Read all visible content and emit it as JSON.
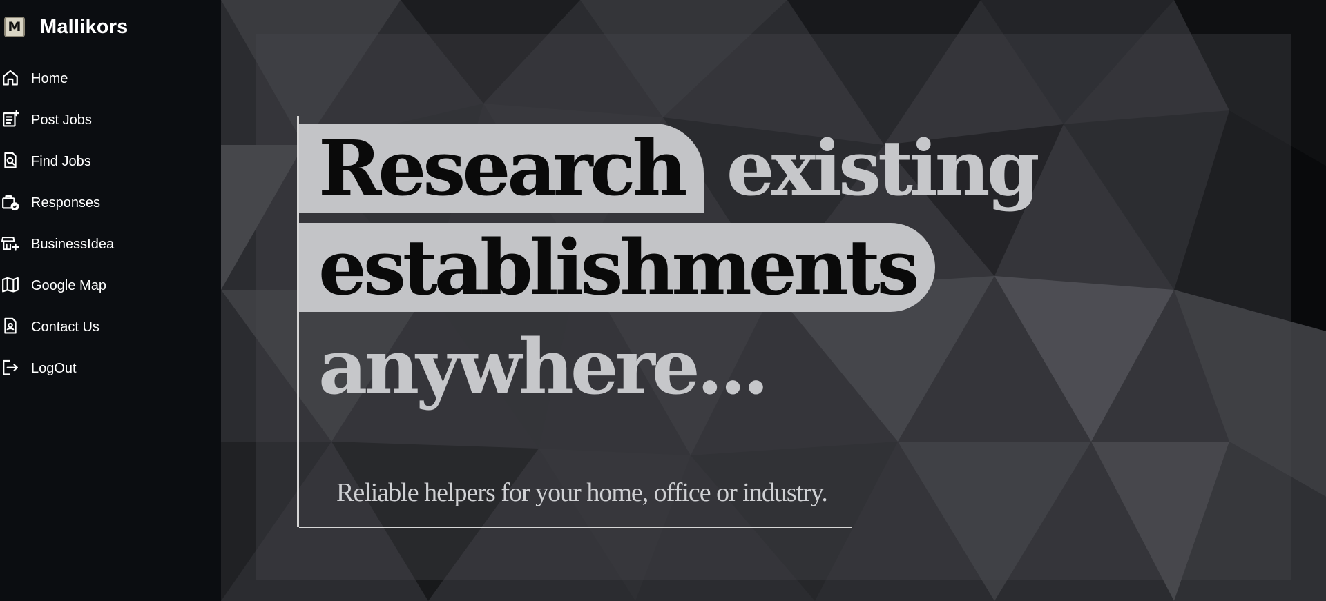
{
  "brand": {
    "logo_letter": "M",
    "name": "Mallikors"
  },
  "nav": {
    "items": [
      {
        "label": "Home",
        "icon": "home-icon"
      },
      {
        "label": "Post Jobs",
        "icon": "post-jobs-icon"
      },
      {
        "label": "Find Jobs",
        "icon": "find-jobs-icon"
      },
      {
        "label": "Responses",
        "icon": "responses-icon"
      },
      {
        "label": "BusinessIdea",
        "icon": "business-idea-icon"
      },
      {
        "label": "Google Map",
        "icon": "map-icon"
      },
      {
        "label": "Contact Us",
        "icon": "contact-icon"
      },
      {
        "label": "LogOut",
        "icon": "logout-icon"
      }
    ]
  },
  "hero": {
    "word_research": "Research",
    "word_existing": "existing",
    "word_establishments": "establishments",
    "word_anywhere": "anywhere...",
    "subtitle": "Reliable helpers for your home, office or industry."
  },
  "colors": {
    "sidebar_bg": "#0b0d11",
    "highlight_bg": "#c3c4c7",
    "text_light": "#c6c7ca"
  }
}
